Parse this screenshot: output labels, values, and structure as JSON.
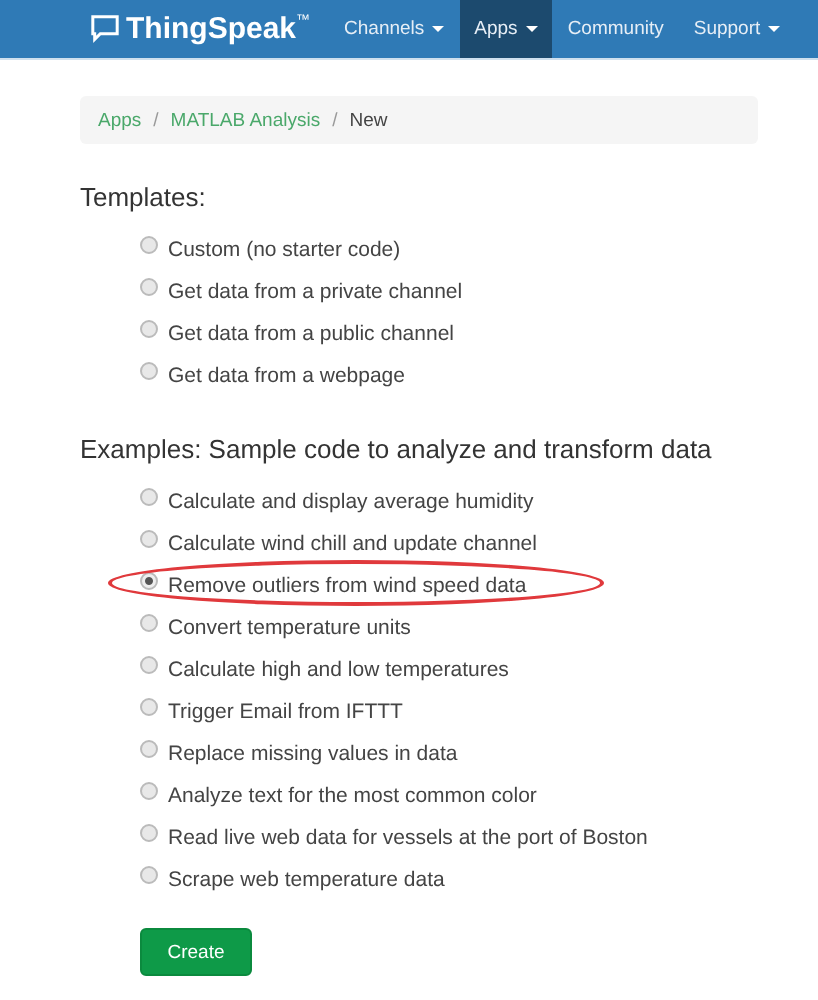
{
  "navbar": {
    "logo": "ThingSpeak",
    "trademark": "™",
    "items": [
      {
        "label": "Channels",
        "has_menu": true,
        "selected": false
      },
      {
        "label": "Apps",
        "has_menu": true,
        "selected": true
      },
      {
        "label": "Community",
        "has_menu": false,
        "selected": false
      },
      {
        "label": "Support",
        "has_menu": true,
        "selected": false
      }
    ]
  },
  "breadcrumb": [
    {
      "label": "Apps",
      "link": true
    },
    {
      "label": "MATLAB Analysis",
      "link": true,
      "separator": "/"
    },
    {
      "label": "New",
      "link": false,
      "separator": "/"
    }
  ],
  "sections": [
    {
      "heading": "Templates:",
      "options": [
        {
          "label": "Custom (no starter code)",
          "selected": false,
          "circled": false
        },
        {
          "label": "Get data from a private channel",
          "selected": false,
          "circled": false
        },
        {
          "label": "Get data from a public channel",
          "selected": false,
          "circled": false
        },
        {
          "label": "Get data from a webpage",
          "selected": false,
          "circled": false
        }
      ]
    },
    {
      "heading": "Examples: Sample code to analyze and transform data",
      "options": [
        {
          "label": "Calculate and display average humidity",
          "selected": false,
          "circled": false
        },
        {
          "label": "Calculate wind chill and update channel",
          "selected": false,
          "circled": false
        },
        {
          "label": "Remove outliers from wind speed data",
          "selected": true,
          "circled": true
        },
        {
          "label": "Convert temperature units",
          "selected": false,
          "circled": false
        },
        {
          "label": "Calculate high and low temperatures",
          "selected": false,
          "circled": false
        },
        {
          "label": "Trigger Email from IFTTT",
          "selected": false,
          "circled": false
        },
        {
          "label": "Replace missing values in data",
          "selected": false,
          "circled": false
        },
        {
          "label": "Analyze text for the most common color",
          "selected": false,
          "circled": false
        },
        {
          "label": "Read live web data for vessels at the port of Boston",
          "selected": false,
          "circled": false
        },
        {
          "label": "Scrape web temperature data",
          "selected": false,
          "circled": false
        }
      ]
    }
  ],
  "button": "Create"
}
